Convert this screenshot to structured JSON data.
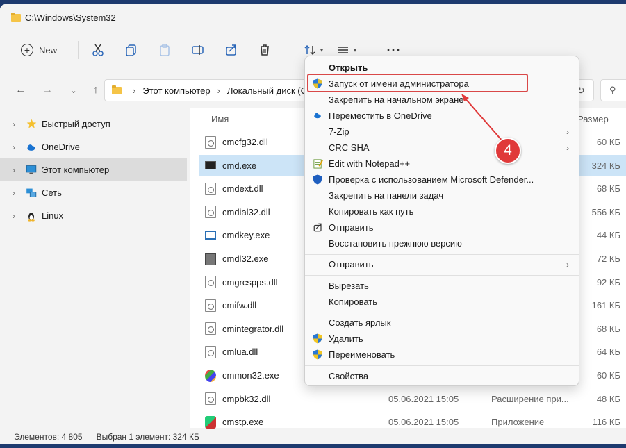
{
  "window": {
    "title": "C:\\Windows\\System32"
  },
  "toolbar": {
    "new_label": "New",
    "icons": [
      "cut-icon",
      "copy-icon",
      "paste-icon",
      "rename-icon",
      "share-icon",
      "delete-icon",
      "sort-icon",
      "view-icon",
      "more-icon"
    ]
  },
  "address": {
    "crumbs": [
      "Этот компьютер",
      "Локальный диск (C:)"
    ],
    "search_icon": "search-icon"
  },
  "sidebar": {
    "items": [
      {
        "label": "Быстрый доступ",
        "icon": "star-icon"
      },
      {
        "label": "OneDrive",
        "icon": "cloud-icon"
      },
      {
        "label": "Этот компьютер",
        "icon": "monitor-icon",
        "selected": true
      },
      {
        "label": "Сеть",
        "icon": "network-icon"
      },
      {
        "label": "Linux",
        "icon": "penguin-icon"
      }
    ]
  },
  "list": {
    "columns": {
      "name": "Имя",
      "size": "Размер"
    },
    "rows": [
      {
        "name": "cmcfg32.dll",
        "date": "",
        "type": "",
        "size": "60 КБ",
        "icon": "dll"
      },
      {
        "name": "cmd.exe",
        "date": "",
        "type": "",
        "size": "324 КБ",
        "icon": "exe",
        "selected": true
      },
      {
        "name": "cmdext.dll",
        "date": "",
        "type": "",
        "size": "68 КБ",
        "icon": "dll"
      },
      {
        "name": "cmdial32.dll",
        "date": "",
        "type": "",
        "size": "556 КБ",
        "icon": "dll"
      },
      {
        "name": "cmdkey.exe",
        "date": "",
        "type": "",
        "size": "44 КБ",
        "icon": "exe2"
      },
      {
        "name": "cmdl32.exe",
        "date": "",
        "type": "",
        "size": "72 КБ",
        "icon": "mdl"
      },
      {
        "name": "cmgrcspps.dll",
        "date": "",
        "type": "",
        "size": "92 КБ",
        "icon": "dll"
      },
      {
        "name": "cmifw.dll",
        "date": "",
        "type": "",
        "size": "161 КБ",
        "icon": "dll"
      },
      {
        "name": "cmintegrator.dll",
        "date": "",
        "type": "",
        "size": "68 КБ",
        "icon": "dll"
      },
      {
        "name": "cmlua.dll",
        "date": "",
        "type": "",
        "size": "64 КБ",
        "icon": "dll"
      },
      {
        "name": "cmmon32.exe",
        "date": "",
        "type": "",
        "size": "60 КБ",
        "icon": "mul"
      },
      {
        "name": "cmpbk32.dll",
        "date": "05.06.2021 15:05",
        "type": "Расширение при...",
        "size": "48 КБ",
        "icon": "dll"
      },
      {
        "name": "cmstp.exe",
        "date": "05.06.2021 15:05",
        "type": "Приложение",
        "size": "116 КБ",
        "icon": "stp"
      }
    ]
  },
  "status": {
    "count": "Элементов: 4 805",
    "selected": "Выбран 1 элемент: 324 КБ"
  },
  "context_menu": {
    "items": [
      {
        "label": "Открыть",
        "bold": true
      },
      {
        "label": "Запуск от имени администратора",
        "icon": "uac-shield-icon"
      },
      {
        "label": "Закрепить на начальном экране"
      },
      {
        "label": "Переместить в OneDrive",
        "icon": "cloud-icon"
      },
      {
        "label": "7-Zip",
        "submenu": true
      },
      {
        "label": "CRC SHA",
        "submenu": true
      },
      {
        "label": "Edit with Notepad++",
        "icon": "notepad-icon"
      },
      {
        "label": "Проверка с использованием Microsoft Defender...",
        "icon": "defender-icon"
      },
      {
        "label": "Закрепить на панели задач"
      },
      {
        "label": "Копировать как путь"
      },
      {
        "label": "Отправить",
        "icon": "share-icon"
      },
      {
        "label": "Восстановить прежнюю версию"
      },
      {
        "label": "Отправить",
        "submenu": true
      },
      {
        "label": "Вырезать"
      },
      {
        "label": "Копировать"
      },
      {
        "label": "Создать ярлык"
      },
      {
        "label": "Удалить",
        "icon": "uac-shield-icon"
      },
      {
        "label": "Переименовать",
        "icon": "uac-shield-icon"
      },
      {
        "label": "Свойства"
      }
    ]
  },
  "annotation": {
    "step": "4",
    "color": "#e0393a"
  }
}
